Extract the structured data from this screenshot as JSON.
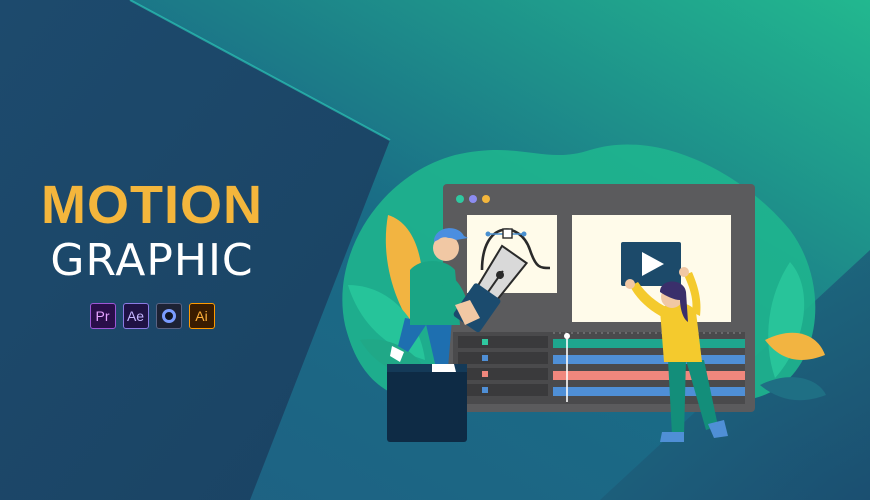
{
  "headline": {
    "line1": "MOTION",
    "line2": "GRAPHIC"
  },
  "apps": [
    {
      "name": "adobe-premiere-pro",
      "label": "Pr",
      "bg": "#2a0e4a",
      "fg": "#e6a3ff",
      "border": "#9e56d6"
    },
    {
      "name": "adobe-after-effects",
      "label": "Ae",
      "bg": "#1f1245",
      "fg": "#c4b6ff",
      "border": "#8b7be4"
    },
    {
      "name": "cinema-4d",
      "label": "",
      "bg": "#1d2234",
      "fg": "#7a9cff",
      "border": "#5a6384"
    },
    {
      "name": "adobe-illustrator",
      "label": "Ai",
      "bg": "#3a1c00",
      "fg": "#ffb13b",
      "border": "#ff9a00"
    }
  ],
  "colors": {
    "navy": "#1b4b6e",
    "teal": "#1fba8f",
    "title_gold": "#f4b63c",
    "title_white": "#ffffff",
    "window": "#5a5a5c",
    "panel": "#fffbea",
    "track_teal": "#1ea68e",
    "track_coral": "#f0877d",
    "track_blue": "#4f8fd6"
  },
  "icons": [
    "play-icon",
    "pen-nib-icon",
    "bezier-curve-icon",
    "leaf-icon"
  ]
}
